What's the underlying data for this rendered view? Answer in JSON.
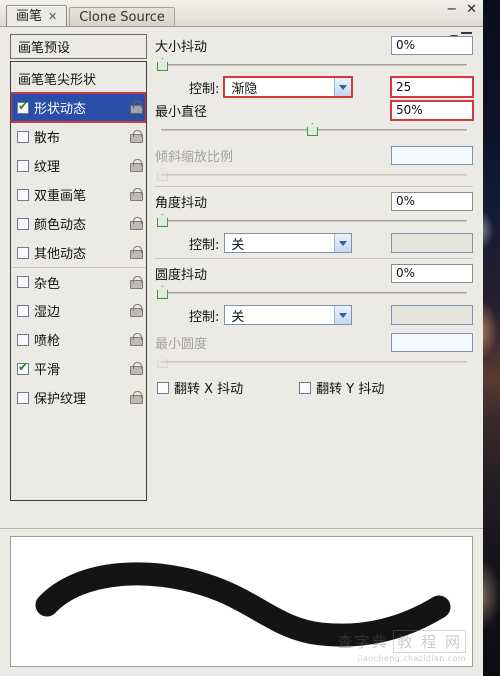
{
  "window": {
    "tabs": [
      {
        "label": "画笔",
        "active": true,
        "close_glyph": "✕"
      },
      {
        "label": "Clone Source",
        "active": false
      }
    ],
    "controls": {
      "minimize": "−",
      "close": "✕"
    },
    "flyout_icon": "panel-menu-icon"
  },
  "sidebar": {
    "preset_label": "画笔预设",
    "items": [
      {
        "label": "画笔笔尖形状",
        "type": "header",
        "checked": null,
        "lock": false,
        "selected": false,
        "separator": false
      },
      {
        "label": "形状动态",
        "type": "option",
        "checked": true,
        "lock": true,
        "selected": true,
        "separator": false,
        "highlight": true
      },
      {
        "label": "散布",
        "type": "option",
        "checked": false,
        "lock": true,
        "selected": false,
        "separator": false
      },
      {
        "label": "纹理",
        "type": "option",
        "checked": false,
        "lock": true,
        "selected": false,
        "separator": false
      },
      {
        "label": "双重画笔",
        "type": "option",
        "checked": false,
        "lock": true,
        "selected": false,
        "separator": false
      },
      {
        "label": "颜色动态",
        "type": "option",
        "checked": false,
        "lock": true,
        "selected": false,
        "separator": false
      },
      {
        "label": "其他动态",
        "type": "option",
        "checked": false,
        "lock": true,
        "selected": false,
        "separator": false
      },
      {
        "label": "杂色",
        "type": "option",
        "checked": false,
        "lock": true,
        "selected": false,
        "separator": true
      },
      {
        "label": "湿边",
        "type": "option",
        "checked": false,
        "lock": true,
        "selected": false,
        "separator": false
      },
      {
        "label": "喷枪",
        "type": "option",
        "checked": false,
        "lock": true,
        "selected": false,
        "separator": false
      },
      {
        "label": "平滑",
        "type": "option",
        "checked": true,
        "lock": true,
        "selected": false,
        "separator": false
      },
      {
        "label": "保护纹理",
        "type": "option",
        "checked": false,
        "lock": true,
        "selected": false,
        "separator": false
      }
    ]
  },
  "options": {
    "size_jitter": {
      "label": "大小抖动",
      "value": "0%",
      "slider_percent": 0
    },
    "size_control": {
      "label": "控制:",
      "selected": "渐隐",
      "fade_steps": "25",
      "highlight_select": true,
      "highlight_steps": true
    },
    "min_diameter": {
      "label": "最小直径",
      "value": "50%",
      "slider_percent": 50,
      "highlight": true
    },
    "tilt_scale": {
      "label": "倾斜缩放比例",
      "value": "",
      "disabled": true,
      "slider_percent": 0
    },
    "angle_jitter": {
      "label": "角度抖动",
      "value": "0%",
      "slider_percent": 0
    },
    "angle_control": {
      "label": "控制:",
      "selected": "关",
      "side_value": ""
    },
    "roundness_jitter": {
      "label": "圆度抖动",
      "value": "0%",
      "slider_percent": 0
    },
    "roundness_control": {
      "label": "控制:",
      "selected": "关",
      "side_value": ""
    },
    "min_roundness": {
      "label": "最小圆度",
      "value": "",
      "disabled": true,
      "slider_percent": 0
    },
    "flip_x": {
      "label": "翻转 X 抖动",
      "checked": false
    },
    "flip_y": {
      "label": "翻转 Y 抖动",
      "checked": false
    }
  },
  "preview": {
    "name": "brush-stroke-preview"
  },
  "watermark": {
    "part1": "查字典",
    "part2": "教 程 网",
    "url": "jiaocheng.chazidian.com"
  },
  "colors": {
    "selection_blue": "#2b4fa8",
    "highlight_red": "#d4373c",
    "knob_green": "#4f8e4a",
    "panel_bg": "#eceae4"
  }
}
